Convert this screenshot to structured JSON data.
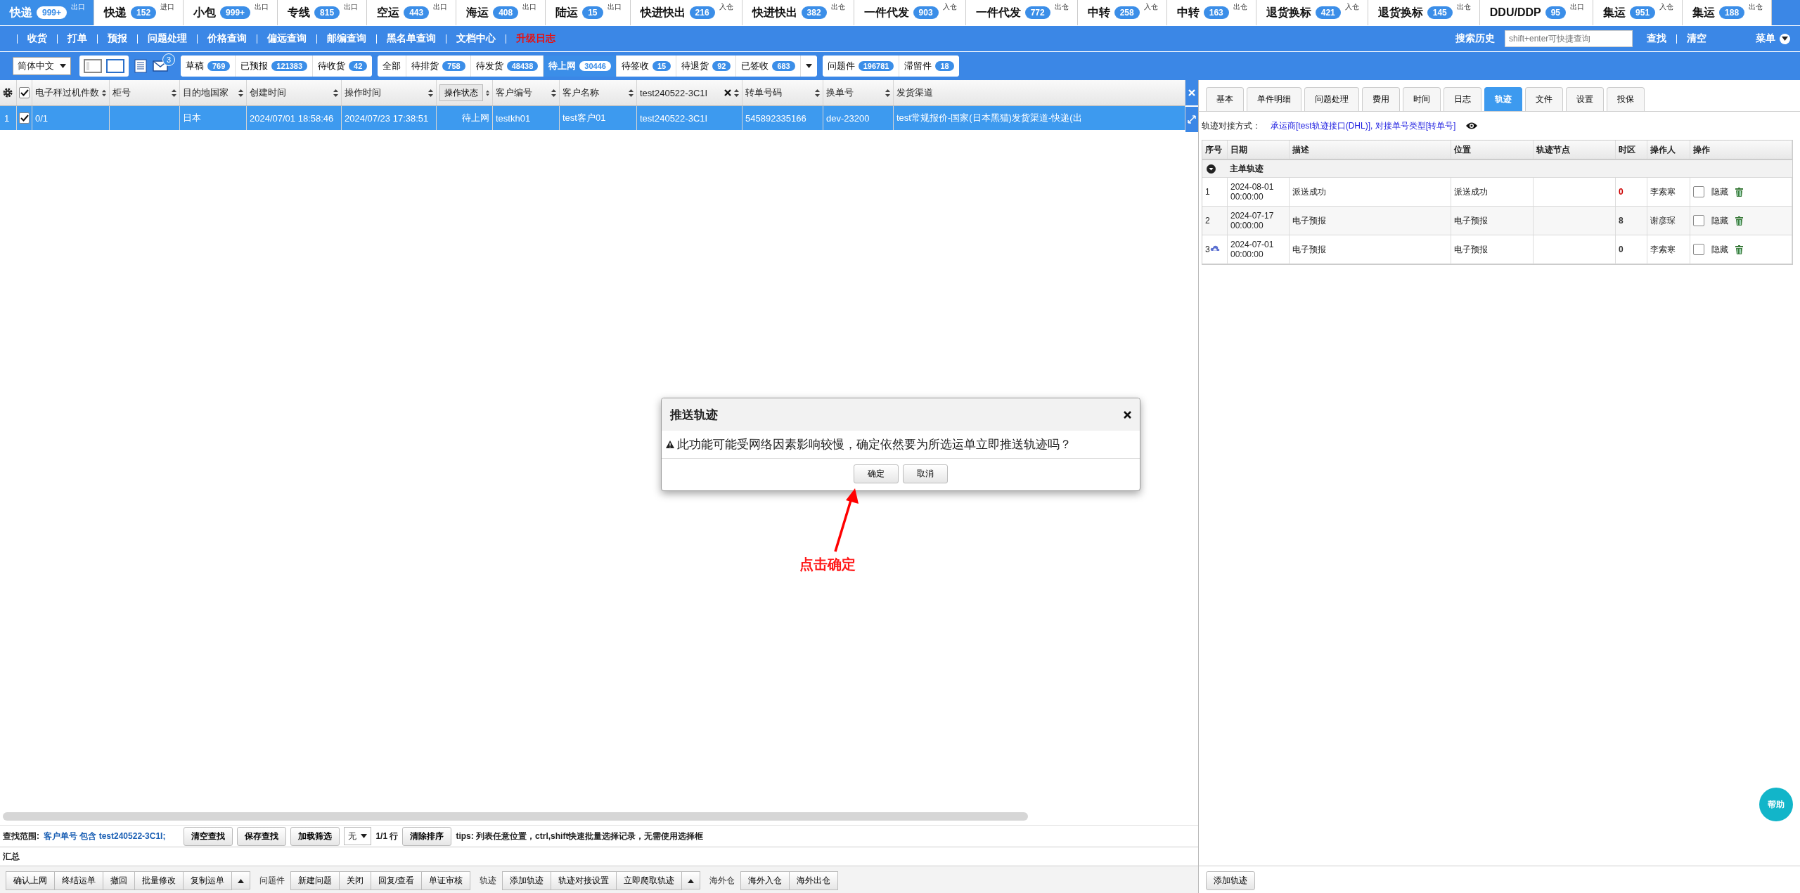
{
  "top_tabs": [
    {
      "label": "快递",
      "count": "999+",
      "tag": "出口",
      "selected": true
    },
    {
      "label": "快递",
      "count": "152",
      "tag": "进口",
      "selected": false
    },
    {
      "label": "小包",
      "count": "999+",
      "tag": "出口",
      "selected": false
    },
    {
      "label": "专线",
      "count": "815",
      "tag": "出口",
      "selected": false
    },
    {
      "label": "空运",
      "count": "443",
      "tag": "出口",
      "selected": false
    },
    {
      "label": "海运",
      "count": "408",
      "tag": "出口",
      "selected": false
    },
    {
      "label": "陆运",
      "count": "15",
      "tag": "出口",
      "selected": false
    },
    {
      "label": "快进快出",
      "count": "216",
      "tag": "入仓",
      "selected": false
    },
    {
      "label": "快进快出",
      "count": "382",
      "tag": "出仓",
      "selected": false
    },
    {
      "label": "一件代发",
      "count": "903",
      "tag": "入仓",
      "selected": false
    },
    {
      "label": "一件代发",
      "count": "772",
      "tag": "出仓",
      "selected": false
    },
    {
      "label": "中转",
      "count": "258",
      "tag": "入仓",
      "selected": false
    },
    {
      "label": "中转",
      "count": "163",
      "tag": "出仓",
      "selected": false
    },
    {
      "label": "退货换标",
      "count": "421",
      "tag": "入仓",
      "selected": false
    },
    {
      "label": "退货换标",
      "count": "145",
      "tag": "出仓",
      "selected": false
    },
    {
      "label": "DDU/DDP",
      "count": "95",
      "tag": "出口",
      "selected": false
    },
    {
      "label": "集运",
      "count": "951",
      "tag": "入仓",
      "selected": false
    },
    {
      "label": "集运",
      "count": "188",
      "tag": "出仓",
      "selected": false
    }
  ],
  "menu": {
    "items": [
      {
        "label": "收货",
        "kind": "link"
      },
      {
        "label": "打单",
        "kind": "link"
      },
      {
        "label": "预报",
        "kind": "link"
      },
      {
        "label": "问题处理",
        "kind": "link"
      },
      {
        "label": "价格查询",
        "kind": "link"
      },
      {
        "label": "偏远查询",
        "kind": "link"
      },
      {
        "label": "邮编查询",
        "kind": "link"
      },
      {
        "label": "黑名单查询",
        "kind": "link"
      },
      {
        "label": "文档中心",
        "kind": "link"
      },
      {
        "label": "升级日志",
        "kind": "highlight"
      }
    ],
    "history": "搜索历史",
    "placeholder": "shift+enter可快捷查询",
    "find": "查找",
    "clear": "清空",
    "menu": "菜单"
  },
  "toolbar": {
    "language": "简体中文",
    "mail_count": "3",
    "groups": [
      {
        "items": [
          {
            "label": "草稿",
            "count": "769",
            "selected": false
          },
          {
            "label": "已预报",
            "count": "121383",
            "selected": false
          },
          {
            "label": "待收货",
            "count": "42",
            "selected": false
          }
        ]
      },
      {
        "more": true,
        "items": [
          {
            "label": "全部",
            "selected": false
          },
          {
            "label": "待排货",
            "count": "758",
            "selected": false
          },
          {
            "label": "待发货",
            "count": "48438",
            "selected": false
          },
          {
            "label": "待上网",
            "count": "30446",
            "selected": true
          },
          {
            "label": "待签收",
            "count": "15",
            "selected": false
          },
          {
            "label": "待退货",
            "count": "92",
            "selected": false
          },
          {
            "label": "已签收",
            "count": "683",
            "selected": false
          }
        ]
      },
      {
        "items": [
          {
            "label": "问题件",
            "count": "196781",
            "selected": false
          },
          {
            "label": "滞留件",
            "count": "18",
            "selected": false
          }
        ]
      }
    ]
  },
  "table": {
    "all_checked": true,
    "columns": [
      {
        "label": "电子秤过机件数",
        "kind": "sort"
      },
      {
        "label": "柜号",
        "kind": "sort"
      },
      {
        "label": "目的地国家",
        "kind": "sort"
      },
      {
        "label": "创建时间",
        "kind": "sort"
      },
      {
        "label": "操作时间",
        "kind": "sort"
      },
      {
        "label": "操作状态",
        "kind": "button"
      },
      {
        "label": "客户编号",
        "kind": "sort"
      },
      {
        "label": "客户名称",
        "kind": "sort"
      },
      {
        "label": "test240522-3C1I",
        "kind": "filter"
      },
      {
        "label": "转单号码",
        "kind": "sort"
      },
      {
        "label": "换单号",
        "kind": "sort"
      },
      {
        "label": "发货渠道",
        "kind": "plain"
      }
    ],
    "rows": [
      {
        "number": "1",
        "checked": true,
        "selected": true,
        "cells": [
          "0/1",
          "",
          "日本",
          "2024/07/01 18:58:46",
          "2024/07/23 17:38:51",
          "待上网",
          "testkh01",
          "test客户01",
          "test240522-3C1I",
          "545892335166",
          "dev-23200",
          "test常规报价-国家(日本黑猫)发货渠道-快递(出"
        ]
      }
    ]
  },
  "search_bar": {
    "scope_label": "查找范围:",
    "scope_value": "客户单号 包含 test240522-3C1I;",
    "buttons": [
      "清空查找",
      "保存查找",
      "加载筛选"
    ],
    "select": "无",
    "row_count": "1/1 行",
    "clear_sort": "清除排序",
    "tips": "tips: 列表任意位置，ctrl,shift快速批量选择记录，无需使用选择框"
  },
  "summary": "汇总",
  "actions": [
    {
      "buttons": [
        "确认上网",
        "终结运单",
        "撤回",
        "批量修改",
        "复制运单"
      ],
      "more": true
    },
    {
      "label": "问题件",
      "buttons": [
        "新建问题",
        "关闭",
        "回复/查看",
        "单证审核"
      ]
    },
    {
      "label": "轨迹",
      "buttons": [
        "添加轨迹",
        "轨迹对接设置",
        "立即爬取轨迹"
      ],
      "more": true
    },
    {
      "label": "海外仓",
      "buttons": [
        "海外入仓",
        "海外出仓"
      ]
    }
  ],
  "detail": {
    "tabs": [
      {
        "label": "基本",
        "selected": false
      },
      {
        "label": "单件明细",
        "selected": false
      },
      {
        "label": "问题处理",
        "selected": false
      },
      {
        "label": "费用",
        "selected": false
      },
      {
        "label": "时间",
        "selected": false
      },
      {
        "label": "日志",
        "selected": false
      },
      {
        "label": "轨迹",
        "selected": true
      },
      {
        "label": "文件",
        "selected": false
      },
      {
        "label": "设置",
        "selected": false
      },
      {
        "label": "投保",
        "selected": false
      }
    ],
    "method_label": "轨迹对接方式：",
    "method_value": "承运商[test轨迹接口(DHL)], 对接单号类型[转单号]",
    "columns": [
      "序号",
      "日期",
      "描述",
      "位置",
      "轨迹节点",
      "时区",
      "操作人",
      "操作"
    ],
    "group": {
      "label": "主单轨迹",
      "expanded": true
    },
    "rows": [
      {
        "number": "1",
        "date": "2024-08-01 00:00:00",
        "description": "派送成功",
        "location": "派送成功",
        "node": "",
        "zone": "0",
        "color": "#cc0000",
        "operator": "李索寒",
        "hidden": false,
        "hide_label": "隐藏"
      },
      {
        "number": "2",
        "date": "2024-07-17 00:00:00",
        "description": "电子预报",
        "location": "电子预报",
        "node": "",
        "zone": "8",
        "color": "#333333",
        "operator": "谢彦琛",
        "hidden": false,
        "hide_label": "隐藏"
      },
      {
        "number": "3",
        "pushed": true,
        "date": "2024-07-01 00:00:00",
        "description": "电子预报",
        "location": "电子预报",
        "node": "",
        "zone": "0",
        "color": "#333333",
        "operator": "李索寒",
        "hidden": false,
        "hide_label": "隐藏"
      }
    ],
    "add_button": "添加轨迹",
    "help": "帮助"
  },
  "dialog": {
    "title": "推送轨迹",
    "message": "此功能可能受网络因素影响较慢，确定依然要为所选运单立即推送轨迹吗？",
    "confirm": "确定",
    "cancel": "取消"
  },
  "annotation": {
    "text": "点击确定"
  }
}
